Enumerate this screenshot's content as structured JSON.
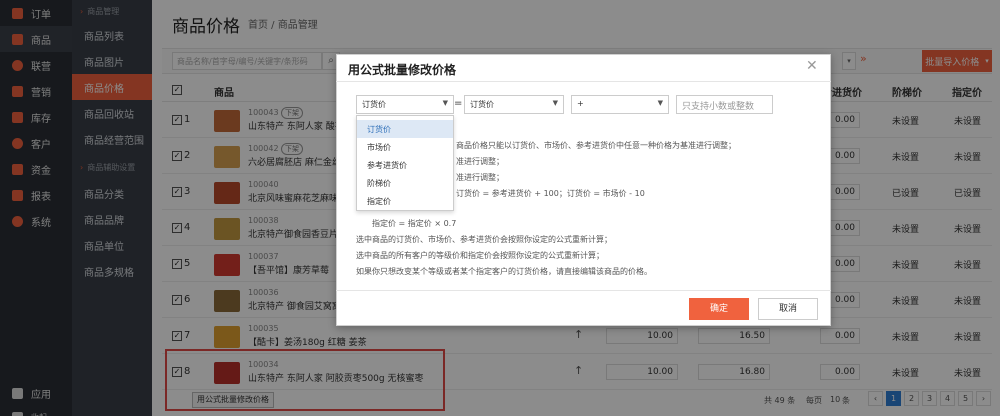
{
  "nav_primary": [
    {
      "label": "订单",
      "icon": "order-icon",
      "color": "#f0623e"
    },
    {
      "label": "商品",
      "icon": "goods-icon",
      "color": "#f0623e"
    },
    {
      "label": "联营",
      "icon": "partner-icon",
      "color": "#f0623e"
    },
    {
      "label": "营销",
      "icon": "marketing-icon",
      "color": "#f0623e"
    },
    {
      "label": "库存",
      "icon": "stock-icon",
      "color": "#f0623e"
    },
    {
      "label": "客户",
      "icon": "customer-icon",
      "color": "#f0623e"
    },
    {
      "label": "资金",
      "icon": "fund-icon",
      "color": "#f0623e"
    },
    {
      "label": "报表",
      "icon": "report-icon",
      "color": "#f0623e"
    },
    {
      "label": "系统",
      "icon": "settings-icon",
      "color": "#f0623e"
    }
  ],
  "nav_bottom": {
    "app_label": "应用",
    "more_label": "收起"
  },
  "nav_secondary": {
    "group1": "商品管理",
    "items1": [
      "商品列表",
      "商品图片",
      "商品价格",
      "商品回收站",
      "商品经营范围"
    ],
    "group2": "商品辅助设置",
    "items2": [
      "商品分类",
      "商品品牌",
      "商品单位",
      "商品多规格"
    ]
  },
  "header": {
    "title": "商品价格",
    "breadcrumb": "首页 / 商品管理"
  },
  "filter": {
    "search_placeholder": "商品名称/首字母/编号/关键字/条形码",
    "import_button": "批量导入价格"
  },
  "table": {
    "headers": {
      "goods": "商品",
      "cost": "考进货价",
      "tier": "阶梯价",
      "designated": "指定价"
    },
    "rows": [
      {
        "num": "1",
        "id": "100043",
        "tag": "下架",
        "name": "山东特产 东阿人家 酸枣",
        "cost": "0.00",
        "tier": "未设置",
        "designated": "未设置"
      },
      {
        "num": "2",
        "id": "100042",
        "tag": "下架",
        "name": "六必居腐胚店 麻仁金丝",
        "cost": "0.00",
        "tier": "未设置",
        "designated": "未设置"
      },
      {
        "num": "3",
        "id": "100040",
        "tag": "",
        "name": "北京风味蜜麻花芝麻味",
        "cost": "0.00",
        "tier": "已设置",
        "designated": "已设置"
      },
      {
        "num": "4",
        "id": "100038",
        "tag": "",
        "name": "北京特产御食园香豆片",
        "cost": "0.00",
        "tier": "未设置",
        "designated": "未设置"
      },
      {
        "num": "5",
        "id": "100037",
        "tag": "",
        "name": "【吾平馆】康芳草莓",
        "cost": "0.00",
        "tier": "未设置",
        "designated": "未设置"
      },
      {
        "num": "6",
        "id": "100036",
        "tag": "",
        "name": "北京特产 御食园艾窝窝",
        "cost": "0.00",
        "tier": "未设置",
        "designated": "未设置"
      },
      {
        "num": "7",
        "id": "100035",
        "tag": "",
        "name": "【酷卡】姜汤180g 红糖 姜茶",
        "p1": "10.00",
        "p2": "16.50",
        "cost": "0.00",
        "tier": "未设置",
        "designated": "未设置"
      },
      {
        "num": "8",
        "id": "100034",
        "tag": "",
        "name": "山东特产 东阿人家 阿胶贡枣500g 无核蜜枣",
        "p1": "10.00",
        "p2": "16.80",
        "cost": "0.00",
        "tier": "未设置",
        "designated": "未设置"
      }
    ],
    "thumb_colors": [
      "#c46a3a",
      "#d8a050",
      "#b84a2a",
      "#c49a40",
      "#d23a30",
      "#8a6a3a",
      "#e0a030",
      "#b8302a"
    ]
  },
  "bulk_button": "用公式批量修改价格",
  "pager": {
    "total": "共 49 条",
    "per_page_label": "每页",
    "per_page": "10",
    "unit": "条",
    "pages": [
      "1",
      "2",
      "3",
      "4",
      "5"
    ]
  },
  "modal": {
    "title": "用公式批量修改价格",
    "sel1": "订货价",
    "equals": "=",
    "sel2": "订货价",
    "sel3": "+",
    "input_placeholder": "只支持小数或整数",
    "options": [
      "订货价",
      "市场价",
      "参考进货价",
      "阶梯价",
      "指定价"
    ],
    "desc": [
      "商品价格只能以订货价、市场价、参考进货价中任意一种价格为基准进行调整；",
      "准进行调整；",
      "准进行调整；",
      "订货价 = 参考进货价 + 100；订货价 = 市场价 - 10",
      "指定价 = 指定价 × 0.7",
      "选中商品的订货价、市场价、参考进货价会按照你设定的公式重新计算；",
      "选中商品的所有客户的等级价和指定价会按照你设定的公式重新计算；",
      "如果你只想改变某个等级或者某个指定客户的订货价格，请直接编辑该商品的价格。"
    ],
    "ok": "确定",
    "cancel": "取消"
  }
}
